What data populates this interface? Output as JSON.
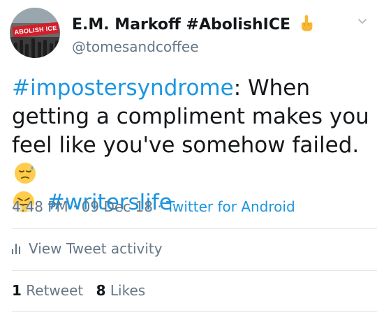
{
  "user": {
    "display_name": "E.M. Markoff #AbolishICE",
    "handle": "@tomesandcoffee",
    "avatar_banner_text": "ABOLISH ICE",
    "display_name_emoji": "middle-finger-emoji"
  },
  "tweet": {
    "hashtag1": "#impostersyndrome",
    "text_main": ": When getting a compliment makes you feel like you've somehow failed.",
    "emoji1": "downcast-sweat-emoji",
    "emoji2": "steam-nose-emoji",
    "hashtag2": "#writerslife"
  },
  "meta": {
    "time": "4:48 PM",
    "sep1": " · ",
    "date": "09 Dec 18",
    "sep2": " · ",
    "source": "Twitter for Android"
  },
  "activity": {
    "label": "View Tweet activity",
    "icon": "bar-chart-icon"
  },
  "stats": {
    "retweet_count": "1",
    "retweet_label": "Retweet",
    "likes_count": "8",
    "likes_label": "Likes"
  },
  "colors": {
    "link": "#1b95e0",
    "secondary": "#657786",
    "text": "#14171a",
    "divider": "#e1e8ed"
  }
}
